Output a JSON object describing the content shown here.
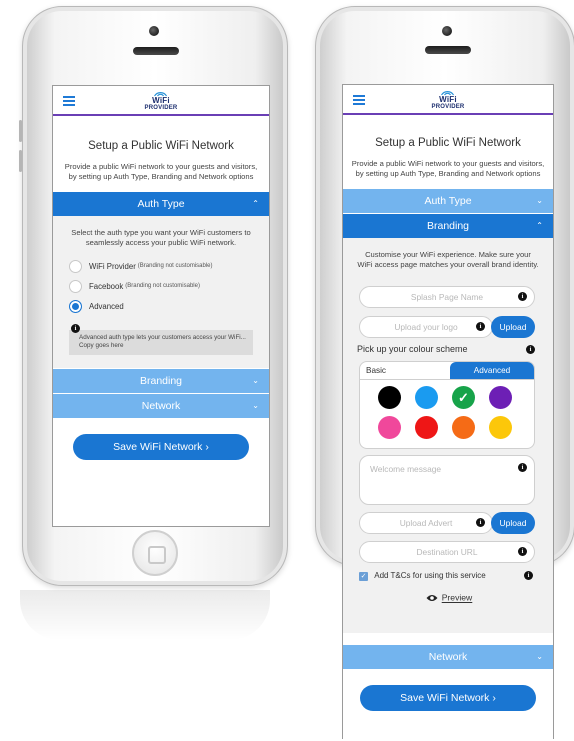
{
  "logo": {
    "line1": "WiFi",
    "line2": "PROVIDER"
  },
  "left": {
    "title": "Setup a Public WiFi Network",
    "description": "Provide a public WiFi network to your guests and visitors, by setting up Auth Type, Branding and Network options",
    "auth_type": {
      "label": "Auth Type",
      "intro": "Select the auth type you want your WiFi customers to seamlessly access your public WiFi network.",
      "options": [
        {
          "label": "WiFi Provider",
          "note": "(Branding not customisable)",
          "checked": false
        },
        {
          "label": "Facebook",
          "note": "(Branding not customisable)",
          "checked": false
        },
        {
          "label": "Advanced",
          "note": "",
          "checked": true
        }
      ],
      "info": "Advanced auth type lets your customers access your WiFi... Copy goes here"
    },
    "branding_label": "Branding",
    "network_label": "Network",
    "save_label": "Save WiFi Network ›"
  },
  "right": {
    "title": "Setup a Public WiFi Network",
    "description": "Provide a public WiFi network to your guests and visitors, by setting up Auth Type, Branding and Network options",
    "auth_type_label": "Auth Type",
    "branding": {
      "label": "Branding",
      "intro": "Customise your WiFi experience. Make sure your WiFi access page matches your overall brand identity.",
      "splash_placeholder": "Splash Page Name",
      "logo_placeholder": "Upload your logo",
      "upload_label": "Upload",
      "colour_heading": "Pick up your colour scheme",
      "tab_basic": "Basic",
      "tab_advanced": "Advanced",
      "colours": [
        {
          "name": "black",
          "hex": "#000000",
          "selected": false
        },
        {
          "name": "blue",
          "hex": "#1a9bf0",
          "selected": false
        },
        {
          "name": "green",
          "hex": "#17a34a",
          "selected": true
        },
        {
          "name": "purple",
          "hex": "#6d1fb5",
          "selected": false
        },
        {
          "name": "pink",
          "hex": "#f0489b",
          "selected": false
        },
        {
          "name": "red",
          "hex": "#ee1616",
          "selected": false
        },
        {
          "name": "orange",
          "hex": "#f56b16",
          "selected": false
        },
        {
          "name": "yellow",
          "hex": "#fcc70a",
          "selected": false
        }
      ],
      "welcome_placeholder": "Welcome message",
      "advert_placeholder": "Upload Advert",
      "advert_upload_label": "Upload",
      "destination_placeholder": "Destination URL",
      "tcs_label": "Add T&Cs for using this service",
      "tcs_checked": true,
      "preview_label": "Preview"
    },
    "network_label": "Network",
    "save_label": "Save WiFi Network ›"
  },
  "colors": {
    "accent": "#1a76d2",
    "accent_light": "#73b4ee",
    "brand_purple": "#6a3fb5"
  }
}
